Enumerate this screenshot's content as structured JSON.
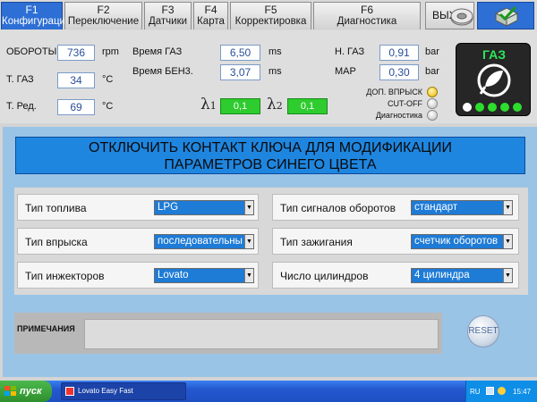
{
  "tabs": [
    {
      "key": "F1",
      "label": "Конфигурация",
      "active": true
    },
    {
      "key": "F2",
      "label": "Переключение",
      "active": false
    },
    {
      "key": "F3",
      "label": "Датчики",
      "active": false
    },
    {
      "key": "F4",
      "label": "Карта",
      "active": false
    },
    {
      "key": "F5",
      "label": "Корректировка",
      "active": false
    },
    {
      "key": "F6",
      "label": "Диагностика",
      "active": false
    }
  ],
  "exit_label": "ВЫХ",
  "sensors": {
    "rpm": {
      "label": "ОБОРОТЫ",
      "value": "736",
      "unit": "rpm"
    },
    "t_gas": {
      "label": "Т. ГАЗ",
      "value": "34",
      "unit": "°C"
    },
    "t_red": {
      "label": "Т. Ред.",
      "value": "69",
      "unit": "°C"
    },
    "time_gas": {
      "label": "Время ГАЗ",
      "value": "6,50",
      "unit": "ms"
    },
    "time_petrol": {
      "label": "Время БЕН3.",
      "value": "3,07",
      "unit": "ms"
    },
    "p_gas": {
      "label": "Н. ГАЗ",
      "value": "0,91",
      "unit": "bar"
    },
    "map": {
      "label": "MAP",
      "value": "0,30",
      "unit": "bar"
    },
    "lambda1": {
      "symbol": "λ",
      "index": "1",
      "value": "0,1"
    },
    "lambda2": {
      "symbol": "λ",
      "index": "2",
      "value": "0,1"
    }
  },
  "indicators": [
    {
      "label": "ДОП. ВПРЫСК",
      "on": true
    },
    {
      "label": "CUT-OFF",
      "on": false
    },
    {
      "label": "Диагностика",
      "on": false
    }
  ],
  "gas_badge": {
    "title": "ГАЗ"
  },
  "warning": {
    "line1": "ОТКЛЮЧИТЬ КОНТАКТ КЛЮЧА ДЛЯ МОДИФИКАЦИИ",
    "line2": "ПАРАМЕТРОВ СИНЕГО ЦВЕТА"
  },
  "settings": {
    "fuel_type": {
      "label": "Тип топлива",
      "value": "LPG"
    },
    "injection_type": {
      "label": "Тип впрыска",
      "value": "последовательный"
    },
    "injector_type": {
      "label": "Тип инжекторов",
      "value": "Lovato"
    },
    "rpm_signal": {
      "label": "Тип сигналов оборотов",
      "value": "стандарт"
    },
    "ignition_type": {
      "label": "Тип зажигания",
      "value": "счетчик оборотов"
    },
    "cylinders": {
      "label": "Число цилиндров",
      "value": "4 цилиндра"
    }
  },
  "notes": {
    "label": "ПРИМЕЧАНИЯ",
    "value": ""
  },
  "reset_label": "RESET",
  "taskbar": {
    "start_label": "пуск",
    "task_label": "Lovato Easy Fast",
    "lang": "RU",
    "time": "15:47"
  },
  "colors": {
    "active_tab": "#2d6fd4",
    "lambda_ok": "#2ecc2e",
    "banner": "#1f86e0",
    "select_bg": "#1e7bd6",
    "panel_blue": "#9ac4e6"
  }
}
